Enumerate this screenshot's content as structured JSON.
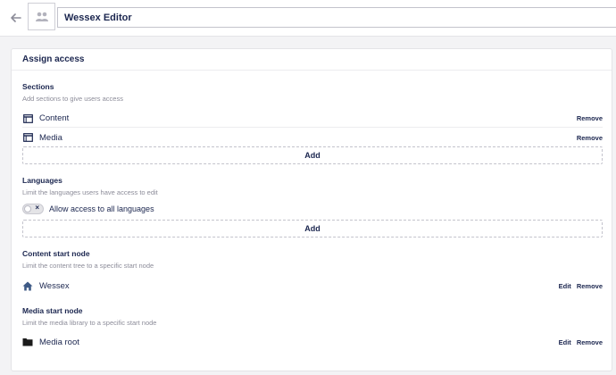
{
  "header": {
    "back_icon": "arrow-left-icon",
    "avatar_icon": "users-icon",
    "group_name": "Wessex Editor"
  },
  "panel": {
    "title": "Assign access",
    "sections": {
      "title": "Sections",
      "description": "Add sections to give users access",
      "items": [
        {
          "label": "Content",
          "icon": "window-icon",
          "remove_label": "Remove"
        },
        {
          "label": "Media",
          "icon": "window-icon",
          "remove_label": "Remove"
        }
      ],
      "add_label": "Add"
    },
    "languages": {
      "title": "Languages",
      "description": "Limit the languages users have access to edit",
      "toggle_label": "Allow access to all languages",
      "toggle_on": false,
      "add_label": "Add"
    },
    "content_start_node": {
      "title": "Content start node",
      "description": "Limit the content tree to a specific start node",
      "item": {
        "label": "Wessex",
        "icon": "home-icon",
        "edit_label": "Edit",
        "remove_label": "Remove"
      }
    },
    "media_start_node": {
      "title": "Media start node",
      "description": "Limit the media library to a specific start node",
      "item": {
        "label": "Media root",
        "icon": "folder-icon",
        "edit_label": "Edit",
        "remove_label": "Remove"
      }
    }
  },
  "colors": {
    "text_primary": "#1b264f",
    "text_muted": "#8c8c99",
    "page_background": "#f3f3f5",
    "panel_background": "#ffffff"
  }
}
